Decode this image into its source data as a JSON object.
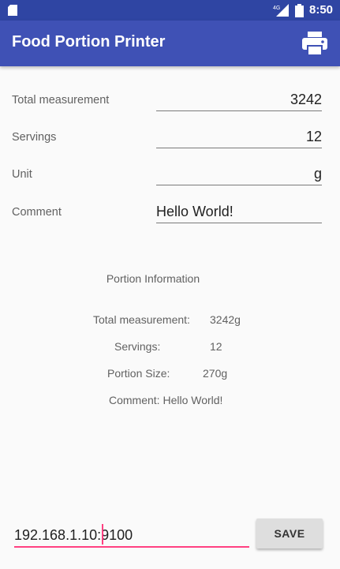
{
  "status_bar": {
    "network": "4G",
    "time": "8:50"
  },
  "app_bar": {
    "title": "Food Portion Printer",
    "print_icon": "printer-icon"
  },
  "form": {
    "total_label": "Total measurement",
    "total_value": "3242",
    "servings_label": "Servings",
    "servings_value": "12",
    "unit_label": "Unit",
    "unit_value": "g",
    "comment_label": "Comment",
    "comment_value": "Hello World!"
  },
  "portion_info": {
    "title": "Portion Information",
    "total_label": "Total measurement:",
    "total_value": "3242g",
    "servings_label": "Servings:",
    "servings_value": "12",
    "portion_label": "Portion Size:",
    "portion_value": "270g",
    "comment": "Comment: Hello World!"
  },
  "bottom": {
    "ip_value": "192.168.1.10:9100",
    "save_label": "SAVE"
  },
  "colors": {
    "status_bar": "#2f45a3",
    "app_bar": "#3f51b5",
    "accent": "#ff4081"
  }
}
